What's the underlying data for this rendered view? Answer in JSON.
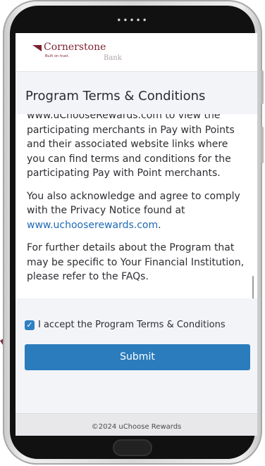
{
  "device": {
    "status_dots": "•••••"
  },
  "header": {
    "brand_name": "Cornerstone",
    "brand_tagline": "Built on trust.",
    "brand_sub": "Bank"
  },
  "page": {
    "title": "Program Terms & Conditions"
  },
  "terms": {
    "partial_line": "www.uChooseRewards.com to view the",
    "para1": "participating merchants in Pay with Points and their associated website links where you can find terms and conditions for the participating Pay with Point merchants.",
    "para2_text": "You also acknowledge and agree to comply with the Privacy Notice found at",
    "para2_link": "www.uchooserewards.com",
    "para2_end": ".",
    "para3": "For further details about the Program that may be specific to Your Financial Institution, please refer to the FAQs."
  },
  "form": {
    "accept_checked": true,
    "accept_label": "I accept the Program Terms & Conditions",
    "submit_label": "Submit"
  },
  "footer": {
    "copyright": "©2024 uChoose Rewards"
  },
  "colors": {
    "brand": "#7b1f2e",
    "accent": "#2b7cbc",
    "link": "#1f6ab4"
  }
}
